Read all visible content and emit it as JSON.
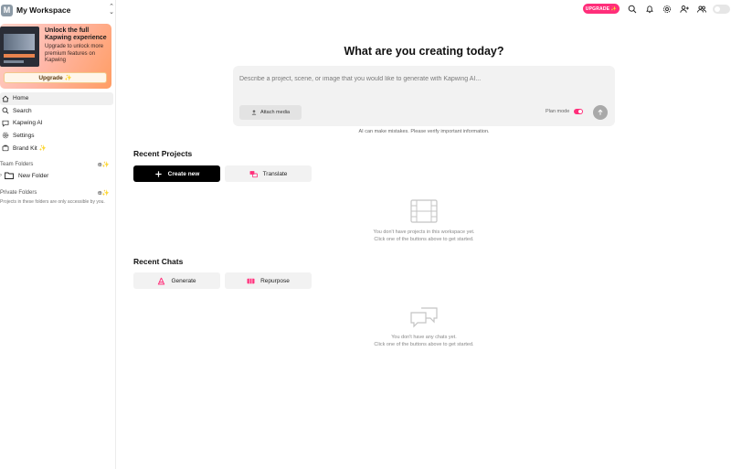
{
  "workspace": {
    "avatar_letter": "M",
    "name": "My Workspace"
  },
  "promo": {
    "title": "Unlock the full Kapwing experience",
    "subtitle": "Upgrade to unlock more premium features on Kapwing",
    "button_label": "Upgrade ✨"
  },
  "nav": {
    "items": [
      {
        "label": "Home",
        "icon": "home-icon"
      },
      {
        "label": "Search",
        "icon": "search-icon"
      },
      {
        "label": "Kapwing AI",
        "icon": "chat-icon"
      },
      {
        "label": "Settings",
        "icon": "gear-icon"
      },
      {
        "label": "Brand Kit ✨",
        "icon": "brand-kit-icon"
      }
    ]
  },
  "folders": {
    "team_label": "Team Folders",
    "team_items": [
      {
        "label": "New Folder"
      }
    ],
    "private_label": "Private Folders",
    "private_note": "Projects in these folders are only accessible by you."
  },
  "topbar": {
    "upgrade_label": "UPGRADE ✨"
  },
  "main": {
    "headline": "What are you creating today?",
    "prompt_placeholder": "Describe a project, scene, or image that you would like to generate with Kapwing AI...",
    "attach_label": "Attach media",
    "plan_mode_label": "Plan mode",
    "disclaimer": "AI can make mistakes. Please verify important information.",
    "recent_projects_title": "Recent Projects",
    "create_new_label": "Create new",
    "translate_label": "Translate",
    "projects_empty_line1": "You don't have projects in this workspace yet.",
    "projects_empty_line2": "Click one of the buttons above to get started.",
    "recent_chats_title": "Recent Chats",
    "generate_label": "Generate",
    "repurpose_label": "Repurpose",
    "chats_empty_line1": "You don't have any chats yet.",
    "chats_empty_line2": "Click one of the buttons above to get started."
  },
  "colors": {
    "accent": "#ff2e7a",
    "primary_button": "#000000",
    "surface": "#f2f2f2"
  }
}
